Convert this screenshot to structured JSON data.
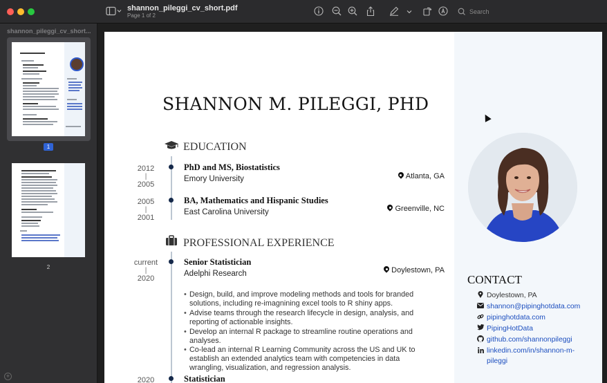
{
  "window": {
    "title": "shannon_pileggi_cv_short.pdf",
    "subtitle": "Page 1 of 2",
    "search_placeholder": "Search"
  },
  "toolbar": {
    "icons": [
      "sidebar-toggle-icon",
      "info-icon",
      "zoom-out-icon",
      "zoom-in-icon",
      "share-icon",
      "markup-pen-icon",
      "chevron-down-icon",
      "rotate-icon",
      "annotate-icon",
      "search-icon"
    ]
  },
  "sidebar": {
    "title": "shannon_pileggi_cv_short...",
    "pages": [
      {
        "label": "1",
        "selected": true
      },
      {
        "label": "2",
        "selected": false
      }
    ]
  },
  "cv": {
    "name": "SHANNON M. PILEGGI, PHD",
    "education": {
      "heading": "EDUCATION",
      "icon": "graduation-cap-icon",
      "entries": [
        {
          "date_end": "2012",
          "sep": "|",
          "date_start": "2005",
          "title": "PhD and MS, Biostatistics",
          "org": "Emory University",
          "location": "Atlanta, GA"
        },
        {
          "date_end": "2005",
          "sep": "|",
          "date_start": "2001",
          "title": "BA, Mathematics and Hispanic Studies",
          "org": "East Carolina University",
          "location": "Greenville, NC"
        }
      ]
    },
    "experience": {
      "heading": "PROFESSIONAL EXPERIENCE",
      "icon": "briefcase-icon",
      "entries": [
        {
          "date_end": "current",
          "sep": "|",
          "date_start": "2020",
          "title": "Senior Statistician",
          "org": "Adelphi Research",
          "location": "Doylestown, PA",
          "bullets": [
            "Design, build, and improve modeling methods and tools for branded solutions, including re-imagnining excel tools to R shiny apps.",
            "Advise teams through the research lifecycle in design, analysis, and reporting of actionable insights.",
            "Develop an internal R package to streamline routine operations and analyses.",
            "Co-lead an internal R Learning Community across the US and UK to establish an extended analytics team with competencies in data wrangling, visualization, and regression analysis."
          ]
        },
        {
          "date_end": "2020",
          "title": "Statistician"
        }
      ]
    },
    "contact": {
      "heading": "CONTACT",
      "items": [
        {
          "icon": "map-pin-icon",
          "text": "Doylestown, PA",
          "link": false
        },
        {
          "icon": "envelope-icon",
          "text": "shannon@pipinghotdata.com",
          "link": true
        },
        {
          "icon": "link-icon",
          "text": "pipinghotdata.com",
          "link": true
        },
        {
          "icon": "twitter-icon",
          "text": "PipingHotData",
          "link": true
        },
        {
          "icon": "github-icon",
          "text": "github.com/shannonpileggi",
          "link": true
        },
        {
          "icon": "linkedin-icon",
          "text": "linkedin.com/in/shannon-m-pileggi",
          "link": true
        }
      ]
    }
  }
}
